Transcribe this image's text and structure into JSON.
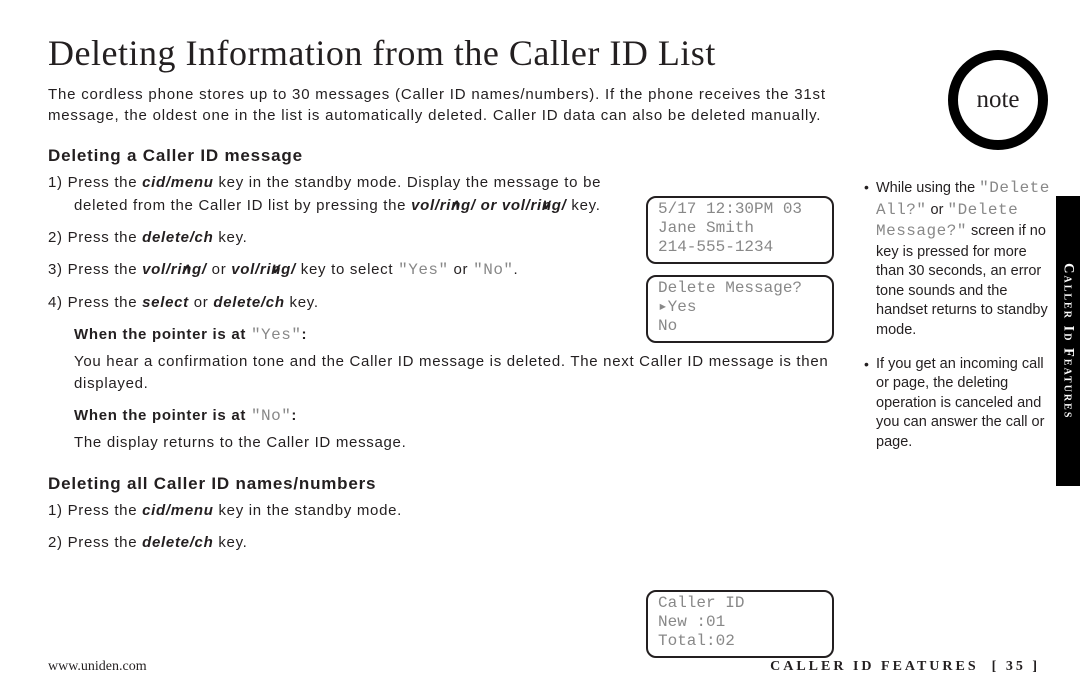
{
  "title": "Deleting Information from the Caller ID List",
  "intro": "The cordless phone stores up to 30 messages (Caller ID names/numbers). If the phone receives the 31st message, the oldest one in the list is automatically deleted. Caller ID data can also be deleted manually.",
  "sections": {
    "delete_one": {
      "heading": "Deleting a Caller ID message",
      "step1_a": "1) Press the ",
      "step1_b": "cid/menu",
      "step1_c": " key in the standby mode. Display the message to be deleted from the Caller ID list by pressing the ",
      "step1_d": "vol/ring/",
      "step1_e": " or ",
      "step1_f": "vol/ring/",
      "step1_g": " key.",
      "step2_a": "2) Press the ",
      "step2_b": "delete/ch",
      "step2_c": " key.",
      "step3_a": "3) Press the ",
      "step3_b": "vol/ring/",
      "step3_c": " or ",
      "step3_d": "vol/ring/",
      "step3_e": " key to select ",
      "step3_yes": "\"Yes\"",
      "step3_or": " or ",
      "step3_no": "\"No\"",
      "step3_f": ".",
      "step4_a": "4) Press the ",
      "step4_b": "select",
      "step4_c": " or ",
      "step4_d": "delete/ch",
      "step4_e": " key.",
      "when_yes_label_a": "When the pointer is at ",
      "when_yes_label_b": "\"Yes\"",
      "when_yes_label_c": ":",
      "when_yes_body": "You hear a confirmation tone and the Caller ID message is deleted. The next Caller ID message is then displayed.",
      "when_no_label_a": "When the pointer is at ",
      "when_no_label_b": "\"No\"",
      "when_no_label_c": ":",
      "when_no_body": "The display returns to the Caller ID message."
    },
    "delete_all": {
      "heading": "Deleting all Caller ID names/numbers",
      "step1_a": "1) Press the ",
      "step1_b": "cid/menu",
      "step1_c": " key in the standby mode.",
      "step2_a": "2) Press the ",
      "step2_b": "delete/ch",
      "step2_c": " key."
    }
  },
  "lcd1": {
    "l1": " 5/17 12:30PM 03",
    "l2": "Jane Smith",
    "l3": "214-555-1234"
  },
  "lcd2": {
    "l1": "Delete Message?",
    "l2": "▸Yes",
    "l3": " No"
  },
  "lcd3": {
    "l1": " Caller ID",
    "l2": " New  :01",
    "l3": " Total:02"
  },
  "note_label": "note",
  "notes": {
    "n1_a": "While using the ",
    "n1_b": "\"Delete All?\"",
    "n1_c": " or ",
    "n1_d": "\"Delete Message?\"",
    "n1_e": " screen if no key is pressed for more than 30 seconds, an error tone sounds and the handset returns to standby mode.",
    "n2": "If you get an incoming call or page, the deleting operation is canceled and you can answer the call or page."
  },
  "tab": "Caller Id Features",
  "footer": {
    "url": "www.uniden.com",
    "section": "CALLER ID FEATURES",
    "page_open": "[ ",
    "page_num": "35",
    "page_close": " ]"
  }
}
